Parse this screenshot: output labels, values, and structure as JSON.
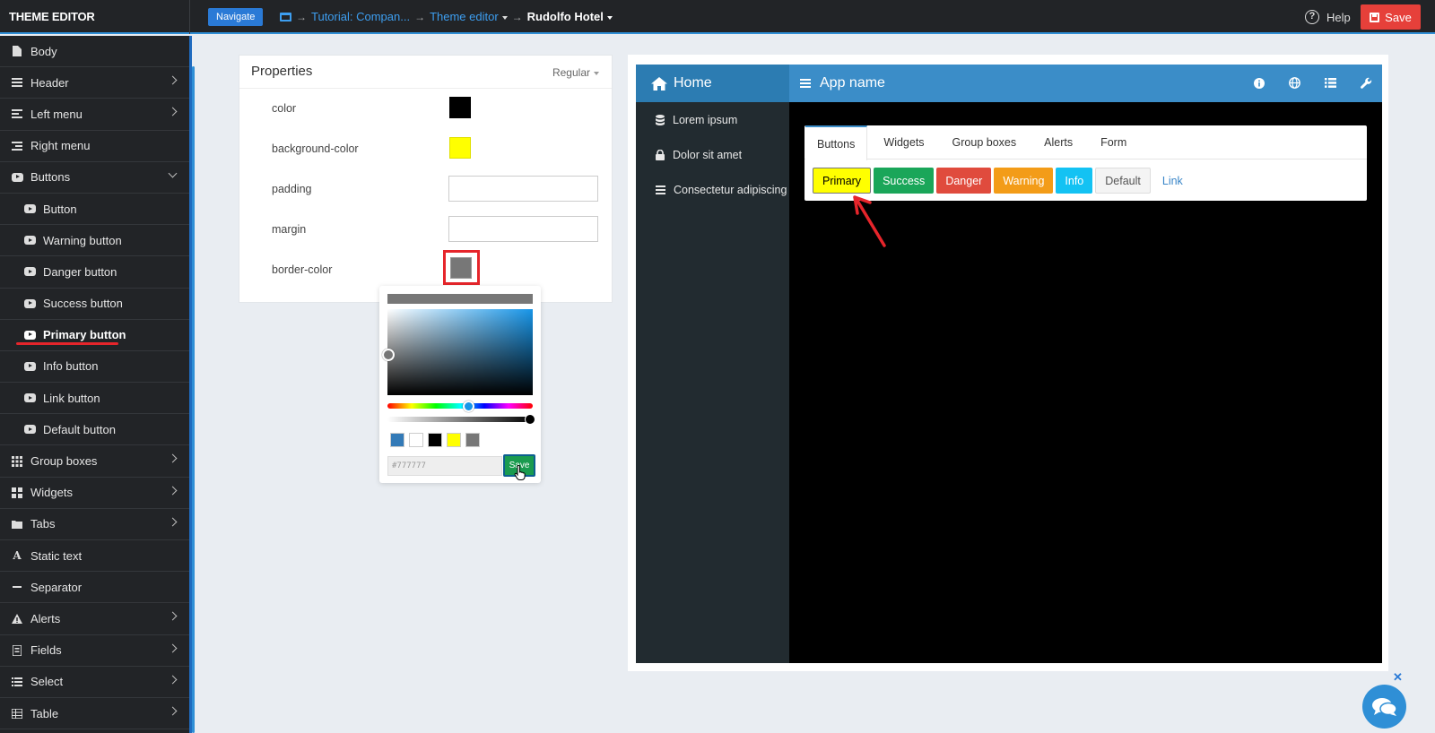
{
  "topbar": {
    "app_title": "THEME EDITOR",
    "navigate_label": "Navigate",
    "breadcrumb": {
      "item1": "Tutorial: Compan...",
      "item2": "Theme editor",
      "item3": "Rudolfo Hotel"
    },
    "help_label": "Help",
    "save_label": "Save"
  },
  "sidebar": {
    "items": [
      {
        "label": "Body",
        "icon": "file-icon"
      },
      {
        "label": "Header",
        "icon": "menu-icon"
      },
      {
        "label": "Left menu",
        "icon": "align-left-icon"
      },
      {
        "label": "Right menu",
        "icon": "align-right-icon"
      },
      {
        "label": "Buttons",
        "icon": "youtube-icon"
      },
      {
        "label": "Button",
        "icon": "youtube-icon"
      },
      {
        "label": "Warning button",
        "icon": "youtube-icon"
      },
      {
        "label": "Danger button",
        "icon": "youtube-icon"
      },
      {
        "label": "Success button",
        "icon": "youtube-icon"
      },
      {
        "label": "Primary button",
        "icon": "youtube-icon"
      },
      {
        "label": "Info button",
        "icon": "youtube-icon"
      },
      {
        "label": "Link button",
        "icon": "youtube-icon"
      },
      {
        "label": "Default button",
        "icon": "youtube-icon"
      },
      {
        "label": "Group boxes",
        "icon": "grid-icon"
      },
      {
        "label": "Widgets",
        "icon": "widgets-icon"
      },
      {
        "label": "Tabs",
        "icon": "folder-icon"
      },
      {
        "label": "Static text",
        "icon": "font-icon"
      },
      {
        "label": "Separator",
        "icon": "minus-icon"
      },
      {
        "label": "Alerts",
        "icon": "warning-icon"
      },
      {
        "label": "Fields",
        "icon": "form-icon"
      },
      {
        "label": "Select",
        "icon": "list-icon"
      },
      {
        "label": "Table",
        "icon": "table-icon"
      }
    ]
  },
  "properties": {
    "title": "Properties",
    "mode": "Regular",
    "rows": {
      "color": "color",
      "background_color": "background-color",
      "padding": "padding",
      "margin": "margin",
      "border_color": "border-color"
    },
    "colors": {
      "color": "#000000",
      "background_color": "#ffff00",
      "border_color": "#777777"
    }
  },
  "color_picker": {
    "hex_value": "#777777",
    "save_label": "Save",
    "swatches": [
      "#337ab7",
      "#ffffff",
      "#000000",
      "#ffff00",
      "#777777"
    ]
  },
  "preview": {
    "brand": "Home",
    "app_name": "App name",
    "side_items": [
      "Lorem ipsum",
      "Dolor sit amet",
      "Consectetur adipiscing"
    ],
    "tabs": [
      "Buttons",
      "Widgets",
      "Group boxes",
      "Alerts",
      "Form"
    ],
    "buttons": {
      "primary": "Primary",
      "success": "Success",
      "danger": "Danger",
      "warning": "Warning",
      "info": "Info",
      "default": "Default",
      "link": "Link"
    }
  }
}
